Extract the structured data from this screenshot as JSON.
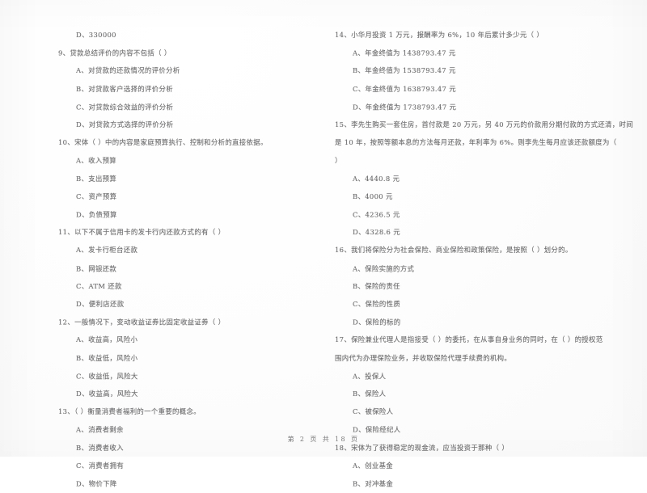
{
  "document": {
    "type": "scanned-exam-paper",
    "footer": "第 2 页 共 18 页"
  },
  "left_column": {
    "blocks": [
      {
        "kind": "option",
        "lines": [
          "D、330000"
        ]
      },
      {
        "kind": "question",
        "stem": [
          "9、贷款总结评价的内容不包括（      ）"
        ],
        "options": [
          "A、对贷款的还款情况的评价分析",
          "B、对贷款客户选择的评价分析",
          "C、对贷款综合效益的评价分析",
          "D、对贷款方式选择的评价分析"
        ]
      },
      {
        "kind": "question",
        "stem": [
          "10、宋体（      ）中的内容是家庭预算执行、控制和分析的直接依据。"
        ],
        "options": [
          "A、收入预算",
          "B、支出预算",
          "C、资产预算",
          "D、负债预算"
        ]
      },
      {
        "kind": "question",
        "stem": [
          "11、以下不属于信用卡的发卡行内还款方式的有（      ）"
        ],
        "options": [
          "A、发卡行柜台还款",
          "B、网银还款",
          "C、ATM 还款",
          "D、便利店还款"
        ]
      },
      {
        "kind": "question",
        "stem": [
          "12、一般情况下，变动收益证券比固定收益证券（      ）"
        ],
        "options": [
          "A、收益高，风险小",
          "B、收益低，风险小",
          "C、收益低，风险大",
          "D、收益高，风险大"
        ]
      },
      {
        "kind": "question",
        "stem": [
          "13、（      ）衡量消费者福利的一个重要的概念。"
        ],
        "options": [
          "A、消费者剩余",
          "B、消费者收入",
          "C、消费者拥有",
          "D、物价下降"
        ]
      }
    ]
  },
  "right_column": {
    "blocks": [
      {
        "kind": "question",
        "stem": [
          "14、小华月投资 1 万元，报酬率为 6%，10 年后累计多少元（      ）"
        ],
        "options": [
          "A、年金终值为 1438793.47 元",
          "B、年金终值为 1538793.47 元",
          "C、年金终值为 1638793.47 元",
          "D、年金终值为 1738793.47 元"
        ]
      },
      {
        "kind": "question",
        "stem": [
          "15、李先生购买一套住房，首付款是 20 万元，另 40 万元的价款用分期付款的方式还清，时间",
          "是 10 年，按照等额本息的方法每月还款，年利率为 6%。则李先生每月应该还款额度为（",
          "）"
        ],
        "options": [
          "A、4440.8 元",
          "B、4000 元",
          "C、4236.5 元",
          "D、4328.6 元"
        ]
      },
      {
        "kind": "question",
        "stem": [
          "16、我们将保险分为社会保险、商业保险和政策保险，是按照（      ）划分的。"
        ],
        "options": [
          "A、保险实施的方式",
          "B、保险的责任",
          "C、保险的性质",
          "D、保险的标的"
        ]
      },
      {
        "kind": "question",
        "stem": [
          "17、保险兼业代理人是指接受（      ）的委托，在从事自身业务的同时，在（      ）的授权范",
          "围内代为办理保险业务，并收取保险代理手续费的机构。"
        ],
        "options": [
          "A、投保人",
          "B、保险人",
          "C、被保险人",
          "D、保险经纪人"
        ]
      },
      {
        "kind": "question",
        "stem": [
          "18、宋体为了获得稳定的现金流，应当投资于那种（      ）"
        ],
        "options": [
          "A、创业基金",
          "B、对冲基金"
        ]
      }
    ]
  }
}
